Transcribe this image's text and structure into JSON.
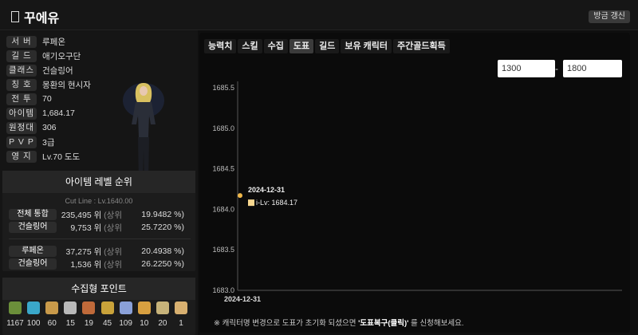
{
  "header": {
    "title": "꾸에유",
    "refresh_label": "방금 갱신"
  },
  "profile": [
    {
      "label": "서 버",
      "value": "루페온"
    },
    {
      "label": "길 드",
      "value": "애기오구단"
    },
    {
      "label": "클래스",
      "value": "건슬링어"
    },
    {
      "label": "칭 호",
      "value": "몽환의 현시자"
    },
    {
      "label": "전 투",
      "value": "70"
    },
    {
      "label": "아이템",
      "value": "1,684.17"
    },
    {
      "label": "원정대",
      "value": "306"
    },
    {
      "label": "P V P",
      "value": "3급"
    },
    {
      "label": "영 지",
      "value": "Lv.70 도도"
    }
  ],
  "ranking": {
    "title": "아이템 레벨 순위",
    "cut_line": "Cut Line : Lv.1640.00",
    "rows": [
      {
        "label": "전체 통합",
        "rank": "235,495 위",
        "top": "(상위",
        "pct": "19.9482 %)"
      },
      {
        "label": "건슬링어",
        "rank": "9,753 위",
        "top": "(상위",
        "pct": "25.7220 %)"
      },
      {
        "label": "루페온",
        "rank": "37,275 위",
        "top": "(상위",
        "pct": "20.4938 %)"
      },
      {
        "label": "건슬링어",
        "rank": "1,536 위",
        "top": "(상위",
        "pct": "26.2250 %)"
      }
    ]
  },
  "collection": {
    "title": "수집형 포인트",
    "items": [
      {
        "icon": "island-heart-icon",
        "color": "#6b8f3a",
        "count": "1167"
      },
      {
        "icon": "orpheus-star-icon",
        "color": "#3aa7c9",
        "count": "100"
      },
      {
        "icon": "giant-heart-icon",
        "color": "#c99a4a",
        "count": "60"
      },
      {
        "icon": "art-piece-icon",
        "color": "#b8b8b8",
        "count": "15"
      },
      {
        "icon": "mokoko-seed-icon",
        "color": "#c06a3a",
        "count": "19"
      },
      {
        "icon": "sea-bounty-icon",
        "color": "#c9a23a",
        "count": "45"
      },
      {
        "icon": "world-tree-leaf-icon",
        "color": "#8aa0d8",
        "count": "109"
      },
      {
        "icon": "ignea-token-icon",
        "color": "#d8a040",
        "count": "10"
      },
      {
        "icon": "orpheus-icon",
        "color": "#c7b37a",
        "count": "20"
      },
      {
        "icon": "voyage-icon",
        "color": "#d8b070",
        "count": "1"
      }
    ]
  },
  "tabs": [
    {
      "label": "능력치",
      "active": false
    },
    {
      "label": "스킬",
      "active": false
    },
    {
      "label": "수집",
      "active": false
    },
    {
      "label": "도표",
      "active": true
    },
    {
      "label": "길드",
      "active": false
    },
    {
      "label": "보유 캐릭터",
      "active": false
    },
    {
      "label": "주간골드획득",
      "active": false
    }
  ],
  "range": {
    "min": "1300",
    "max": "1800",
    "separator": "-"
  },
  "chart_data": {
    "type": "line",
    "x": [
      "2024-12-31"
    ],
    "series": [
      {
        "values": [
          1684.17
        ]
      }
    ],
    "ylim": [
      1683.0,
      1685.5
    ],
    "yticks": [
      "1685.5",
      "1685.0",
      "1684.5",
      "1684.0",
      "1683.5",
      "1683.0"
    ],
    "xticks": [
      "2024-12-31"
    ],
    "tooltip": {
      "date": "2024-12-31",
      "text": "i-Lv: 1684.17"
    },
    "point_color": "#f0b84a",
    "grid": false
  },
  "note": {
    "prefix": "※ 캐릭터명 변경으로 도표가 초기화 되셨으면 ",
    "bold": "'도표복구(클릭)'",
    "suffix": " 를 신청해보세요."
  }
}
